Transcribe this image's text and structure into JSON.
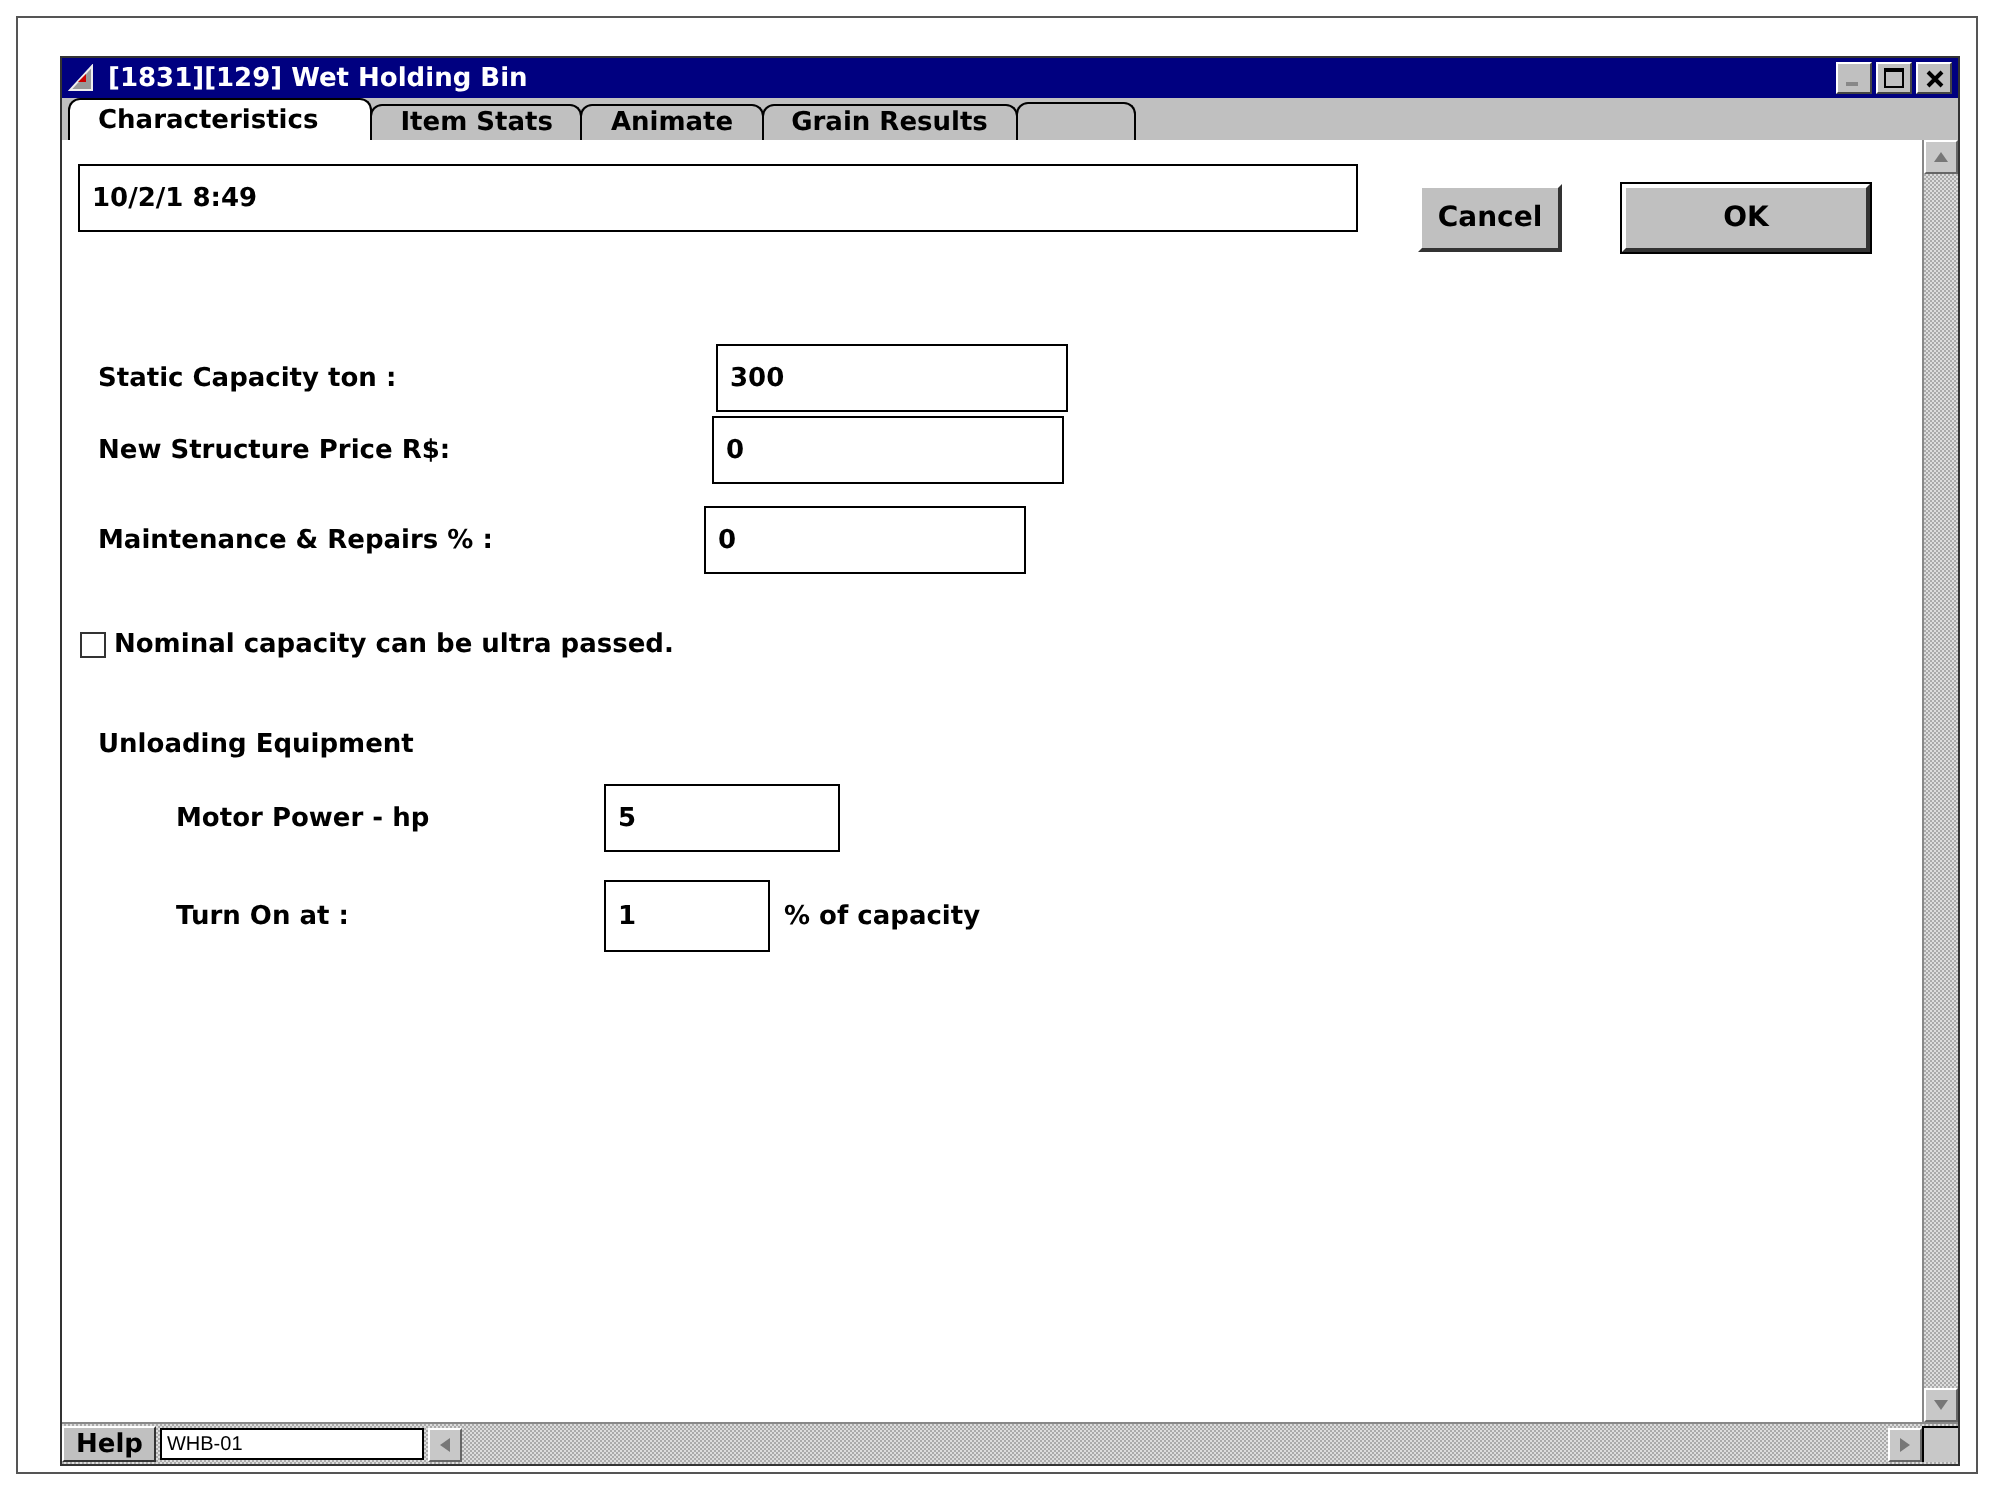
{
  "window": {
    "title": "[1831][129]   Wet Holding Bin"
  },
  "tabs": [
    {
      "label": "Characteristics",
      "selected": true
    },
    {
      "label": "Item Stats",
      "selected": false
    },
    {
      "label": "Animate",
      "selected": false
    },
    {
      "label": "Grain Results",
      "selected": false
    }
  ],
  "timestamp": {
    "value": "10/2/1  8:49"
  },
  "buttons": [
    {
      "label": "Cancel",
      "default": false
    },
    {
      "label": "OK",
      "default": true
    }
  ],
  "fields": [
    {
      "label": "Static Capacity ton :",
      "value": "300"
    },
    {
      "label": "New Structure Price R$:",
      "value": "0"
    },
    {
      "label": "Maintenance & Repairs % :",
      "value": "0"
    }
  ],
  "checkbox": {
    "label": "Nominal capacity can be ultra passed.",
    "checked": false
  },
  "unloading": {
    "heading": "Unloading Equipment",
    "motor_power": {
      "label": "Motor Power - hp",
      "value": "5"
    },
    "turn_on": {
      "label": "Turn On at :",
      "value": "1",
      "suffix": "% of capacity"
    }
  },
  "footer": {
    "help": "Help",
    "code": "WHB-01"
  }
}
